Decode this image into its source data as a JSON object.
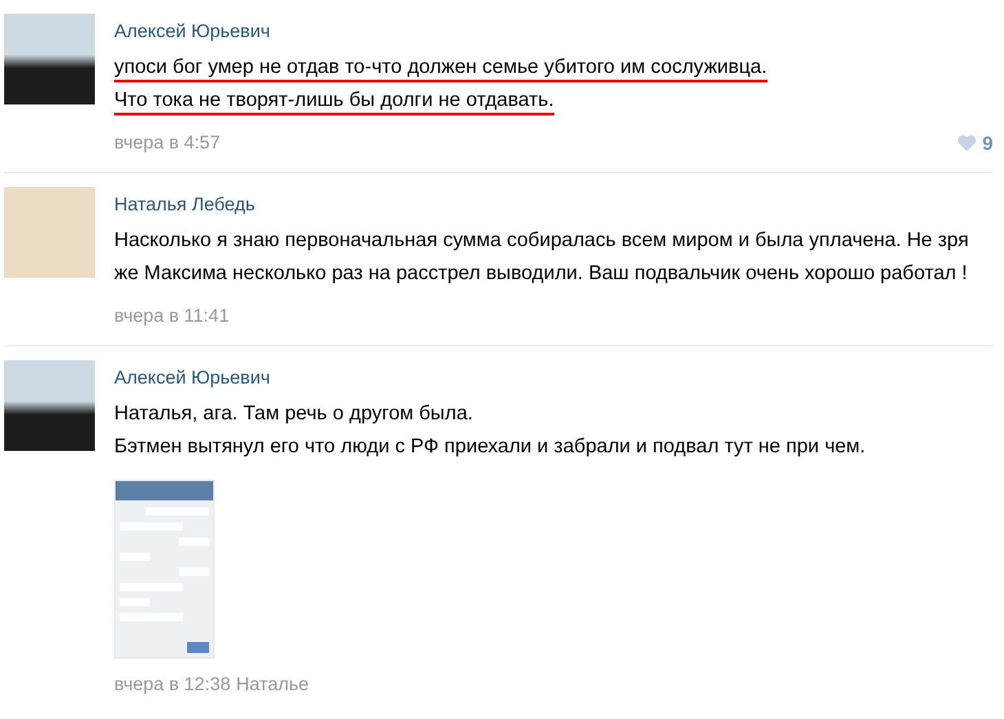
{
  "comments": [
    {
      "author": "Алексей Юрьевич",
      "avatar": {
        "kind": "photo"
      },
      "paragraphs": [
        {
          "text": "упоси бог умер не отдав то-что должен семье убитого им сослуживца.",
          "underlined": true
        },
        {
          "text": "Что тока не творят-лишь бы долги не отдавать.",
          "underlined": true
        }
      ],
      "time": "вчера в 4:57",
      "likes": "9"
    },
    {
      "author": "Наталья Лебедь",
      "avatar": {
        "kind": "drawing"
      },
      "paragraphs": [
        {
          "text": "Насколько я знаю первоначальная сумма собиралась всем миром и была уплачена. Не зря же Максима несколько раз на расстрел выводили. Ваш подвальчик очень хорошо работал !",
          "underlined": false
        }
      ],
      "time": "вчера в 11:41"
    },
    {
      "author": "Алексей Юрьевич",
      "avatar": {
        "kind": "photo"
      },
      "paragraphs": [
        {
          "text": "Наталья, ага. Там речь о другом была.",
          "underlined": false
        },
        {
          "text": "Бэтмен вытянул его что люди с РФ приехали и забрали и подвал тут не при чем.",
          "underlined": false
        }
      ],
      "attachment": true,
      "time": "вчера в 12:38",
      "reply_to": "Наталье"
    }
  ]
}
